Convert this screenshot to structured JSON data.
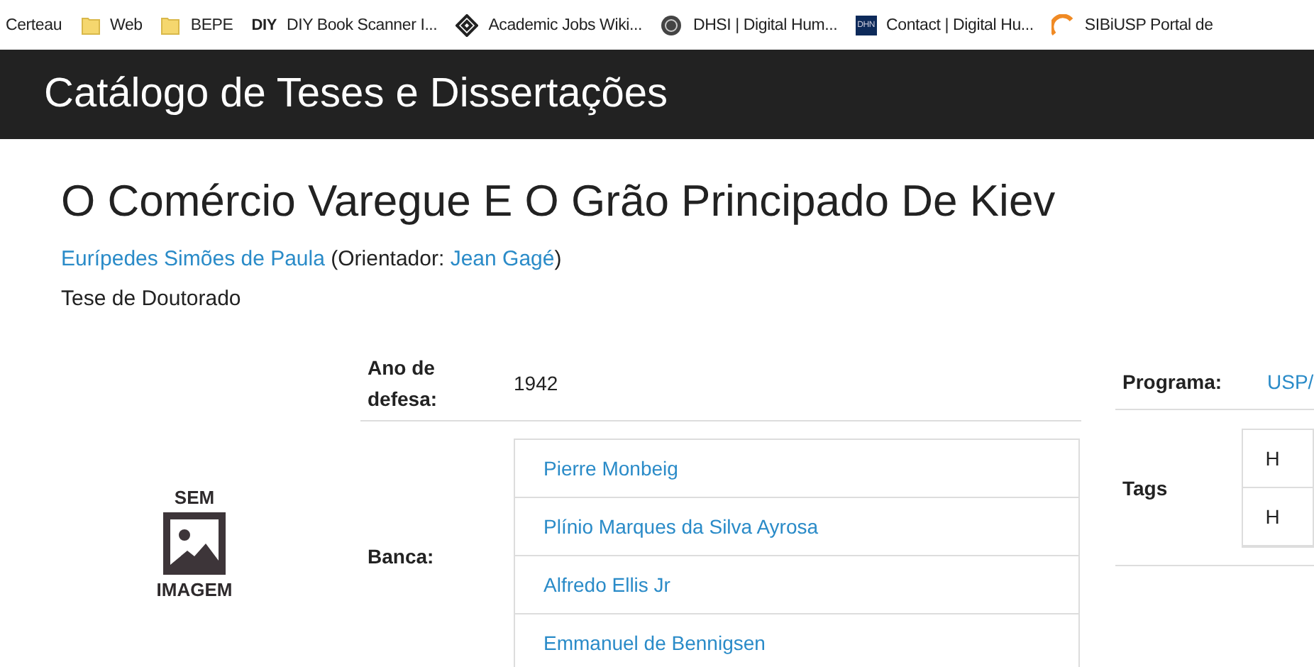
{
  "bookmarks": [
    {
      "label": "Certeau",
      "kind": "none"
    },
    {
      "label": "Web",
      "kind": "folder"
    },
    {
      "label": "BEPE",
      "kind": "folder"
    },
    {
      "label": "DIY Book Scanner I...",
      "kind": "text",
      "icon_text": "DIY"
    },
    {
      "label": "Academic Jobs Wiki...",
      "kind": "diamond"
    },
    {
      "label": "DHSI | Digital Hum...",
      "kind": "globe"
    },
    {
      "label": "Contact | Digital Hu...",
      "kind": "text-badge",
      "icon_text": "DHN"
    },
    {
      "label": "SIBiUSP Portal de",
      "kind": "arc"
    }
  ],
  "header": {
    "title": "Catálogo de Teses e Dissertações"
  },
  "record": {
    "title": "O Comércio Varegue E O Grão Principado De Kiev",
    "author": "Eurípedes Simões de Paula",
    "advisor_prefix": "(Orientador: ",
    "advisor": "Jean Gagé",
    "advisor_suffix": ")",
    "type": "Tese de Doutorado"
  },
  "image": {
    "top": "SEM",
    "bottom": "IMAGEM"
  },
  "details": {
    "year_label": "Ano de defesa:",
    "year": "1942",
    "banca_label": "Banca:",
    "banca": [
      "Pierre Monbeig",
      "Plínio Marques da Silva Ayrosa",
      "Alfredo Ellis Jr",
      "Emmanuel de Bennigsen"
    ]
  },
  "side": {
    "program_label": "Programa:",
    "program": "USP/",
    "tags_label": "Tags",
    "tags": [
      "H",
      "H"
    ]
  }
}
